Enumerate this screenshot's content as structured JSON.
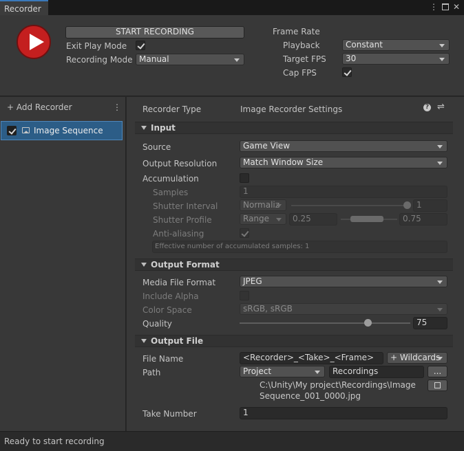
{
  "tab": {
    "title": "Recorder"
  },
  "header": {
    "start_recording_label": "START RECORDING",
    "exit_play_mode_label": "Exit Play Mode",
    "exit_play_mode_checked": true,
    "recording_mode_label": "Recording Mode",
    "recording_mode_value": "Manual",
    "frame_rate_label": "Frame Rate",
    "playback_label": "Playback",
    "playback_value": "Constant",
    "target_fps_label": "Target FPS",
    "target_fps_value": "30",
    "cap_fps_label": "Cap FPS",
    "cap_fps_checked": true
  },
  "left_panel": {
    "add_recorder_label": "+ Add Recorder",
    "recorders": [
      {
        "label": "Image Sequence",
        "enabled": true,
        "selected": true
      }
    ]
  },
  "right_panel": {
    "recorder_type_label": "Recorder Type",
    "recorder_type_value": "Image Recorder Settings",
    "input": {
      "title": "Input",
      "source_label": "Source",
      "source_value": "Game View",
      "output_resolution_label": "Output Resolution",
      "output_resolution_value": "Match Window Size",
      "accumulation_label": "Accumulation",
      "samples_label": "Samples",
      "samples_value": "1",
      "shutter_interval_label": "Shutter Interval",
      "shutter_interval_mode": "Normaliz",
      "shutter_interval_value": "1",
      "shutter_profile_label": "Shutter Profile",
      "shutter_profile_mode": "Range",
      "shutter_profile_min": "0.25",
      "shutter_profile_max": "0.75",
      "anti_aliasing_label": "Anti-aliasing",
      "effective_samples_text": "Effective number of accumulated samples: 1"
    },
    "output_format": {
      "title": "Output Format",
      "media_file_format_label": "Media File Format",
      "media_file_format_value": "JPEG",
      "include_alpha_label": "Include Alpha",
      "color_space_label": "Color Space",
      "color_space_value": "sRGB, sRGB",
      "quality_label": "Quality",
      "quality_value": "75",
      "quality_fraction": 0.75
    },
    "output_file": {
      "title": "Output File",
      "file_name_label": "File Name",
      "file_name_value": "<Recorder>_<Take>_<Frame>",
      "wildcards_label": "+ Wildcards",
      "path_label": "Path",
      "path_root_value": "Project",
      "path_folder_value": "Recordings",
      "browse_label": "...",
      "full_path_line1": "C:\\Unity\\My project\\Recordings\\Image",
      "full_path_line2": "Sequence_001_0000.jpg",
      "take_number_label": "Take Number",
      "take_number_value": "1"
    }
  },
  "status": {
    "text": "Ready to start recording"
  }
}
